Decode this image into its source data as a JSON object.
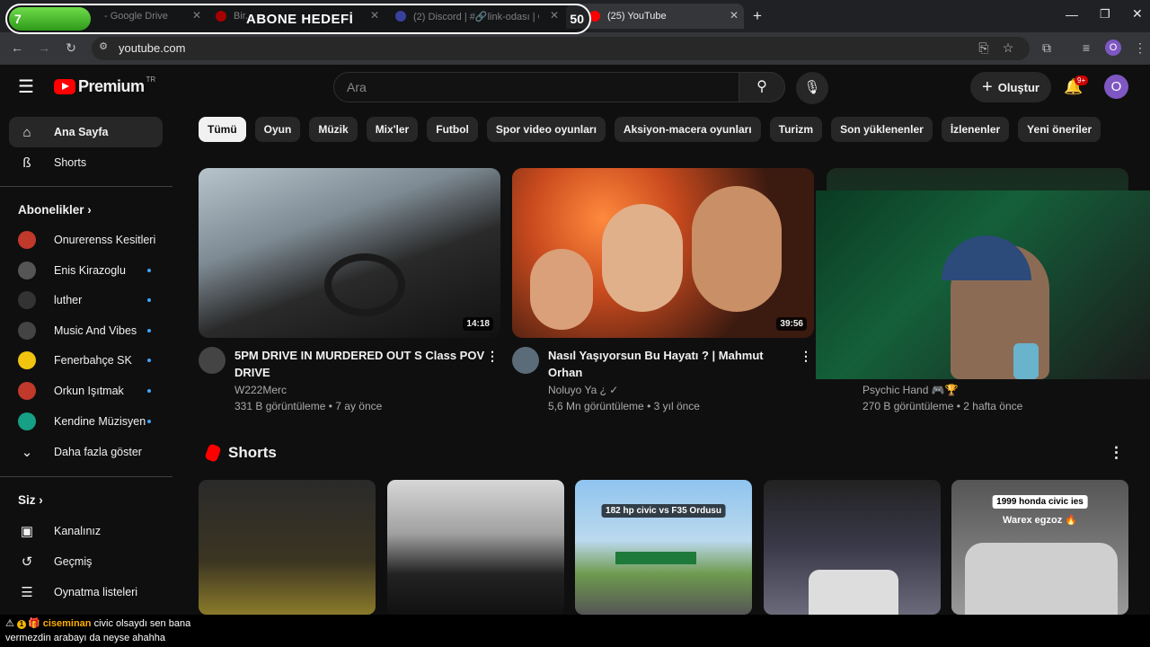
{
  "browser": {
    "tabs": [
      {
        "title": "- Google Drive",
        "active": false
      },
      {
        "title": "Bir...",
        "active": false
      },
      {
        "title": "(2) Discord | #🔗link-odası | Or...",
        "active": false
      },
      {
        "title": "(25) YouTube",
        "active": true
      }
    ],
    "new_tab": "+",
    "url": "youtube.com",
    "profile_initial": "O"
  },
  "subscriber_goal": {
    "title": "ABONE HEDEFİ",
    "start": "7",
    "end": "50",
    "progress": 0.14
  },
  "youtube": {
    "logo": "Premium",
    "logo_country": "TR",
    "search_placeholder": "Ara",
    "create_label": "Oluştur",
    "notif_badge": "9+",
    "user_initial": "O"
  },
  "sidebar": {
    "main": [
      {
        "label": "Ana Sayfa",
        "icon": "home-icon",
        "active": true
      },
      {
        "label": "Shorts",
        "icon": "shorts-icon"
      }
    ],
    "subs_header": "Abonelikler",
    "subs": [
      {
        "label": "Onurerenss Kesitleri",
        "dot": false,
        "color": "#c0392b"
      },
      {
        "label": "Enis Kirazoglu",
        "dot": true,
        "color": "#555"
      },
      {
        "label": "luther",
        "dot": true,
        "color": "#333"
      },
      {
        "label": "Music And Vibes",
        "dot": true,
        "color": "#444"
      },
      {
        "label": "Fenerbahçe SK",
        "dot": true,
        "color": "#f1c40f"
      },
      {
        "label": "Orkun Işıtmak",
        "dot": true,
        "color": "#c0392b"
      },
      {
        "label": "Kendine Müzisyen",
        "dot": true,
        "color": "#16a085"
      }
    ],
    "show_more": "Daha fazla göster",
    "you_header": "Siz",
    "you": [
      {
        "label": "Kanalınız",
        "icon": "channel-icon"
      },
      {
        "label": "Geçmiş",
        "icon": "history-icon"
      },
      {
        "label": "Oynatma listeleri",
        "icon": "playlist-icon"
      }
    ]
  },
  "chips": [
    "Tümü",
    "Oyun",
    "Müzik",
    "Mix'ler",
    "Futbol",
    "Spor video oyunları",
    "Aksiyon-macera oyunları",
    "Turizm",
    "Son yüklenenler",
    "İzlenenler",
    "Yeni öneriler"
  ],
  "videos": [
    {
      "title": "5PM DRIVE IN MURDERED OUT S Class POV DRIVE",
      "channel": "W222Merc",
      "meta": "331 B görüntüleme • 7 ay önce",
      "duration": "14:18"
    },
    {
      "title": "Nasıl Yaşıyorsun Bu Hayatı  ? | Mahmut Orhan",
      "channel": "Noluyo Ya ¿ ✓",
      "meta": "5,6 Mn görüntüleme • 3 yıl önce",
      "duration": "39:56"
    },
    {
      "title": "",
      "channel": "Psychic Hand 🎮🏆",
      "meta": "270 B görüntüleme • 2 hafta önce",
      "duration": ""
    }
  ],
  "shorts": {
    "title": "Shorts",
    "captions": [
      "",
      "",
      "182 hp civic vs F35 Ordusu",
      "",
      "1999 honda civic ies",
      "Warex egzoz 🔥"
    ]
  },
  "chat": {
    "user": "ciseminan",
    "line1": " civic olsaydı sen bana",
    "line2": "vermezdin arabayı da neyse ahahha",
    "badge": "1"
  }
}
